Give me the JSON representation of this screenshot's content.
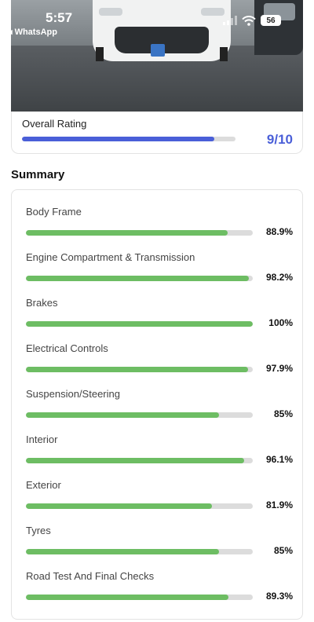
{
  "status_bar": {
    "time": "5:57",
    "back_app": "◂ WhatsApp",
    "battery": "56"
  },
  "overall": {
    "label": "Overall Rating",
    "value": "9/10",
    "fraction": 0.9,
    "color": "#4a5fd8"
  },
  "summary": {
    "title": "Summary",
    "bar_color": "#6dbd63",
    "items": [
      {
        "label": "Body Frame",
        "value": "88.9%",
        "percent": 88.9
      },
      {
        "label": "Engine Compartment & Transmission",
        "value": "98.2%",
        "percent": 98.2
      },
      {
        "label": "Brakes",
        "value": "100%",
        "percent": 100
      },
      {
        "label": "Electrical Controls",
        "value": "97.9%",
        "percent": 97.9
      },
      {
        "label": "Suspension/Steering",
        "value": "85%",
        "percent": 85
      },
      {
        "label": "Interior",
        "value": "96.1%",
        "percent": 96.1
      },
      {
        "label": "Exterior",
        "value": "81.9%",
        "percent": 81.9
      },
      {
        "label": "Tyres",
        "value": "85%",
        "percent": 85
      },
      {
        "label": "Road Test And Final Checks",
        "value": "89.3%",
        "percent": 89.3
      }
    ]
  }
}
